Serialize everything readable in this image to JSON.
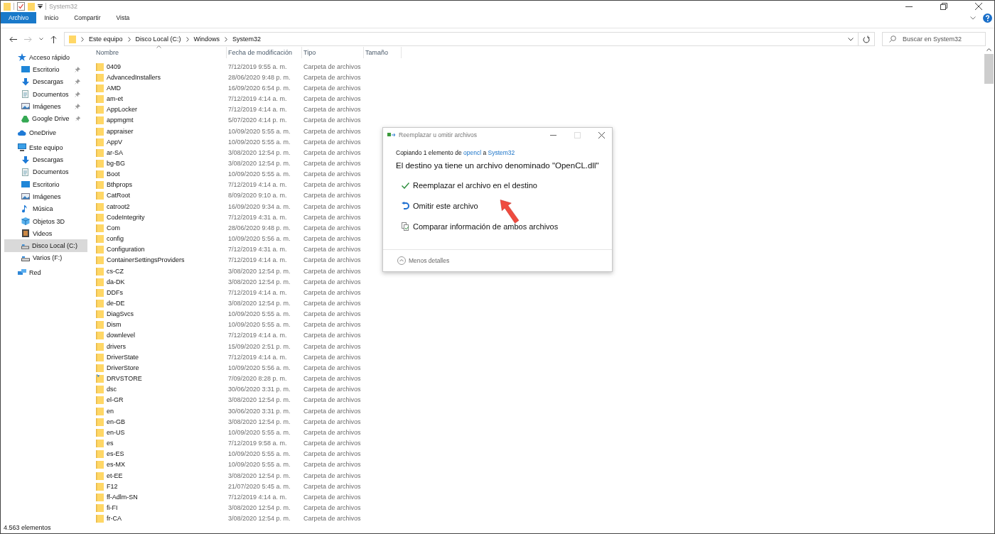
{
  "window": {
    "title": "System32"
  },
  "ribbon_tabs": [
    {
      "label": "Archivo",
      "selected": true
    },
    {
      "label": "Inicio",
      "selected": false
    },
    {
      "label": "Compartir",
      "selected": false
    },
    {
      "label": "Vista",
      "selected": false
    }
  ],
  "address": {
    "segments": [
      "Este equipo",
      "Disco Local (C:)",
      "Windows",
      "System32"
    ]
  },
  "search": {
    "placeholder": "Buscar en System32"
  },
  "sidebar": {
    "items": [
      {
        "label": "Acceso rápido",
        "kind": "star",
        "selected": false,
        "children": [
          {
            "label": "Escritorio",
            "kind": "desktop",
            "pinned": true,
            "selected": false
          },
          {
            "label": "Descargas",
            "kind": "download",
            "pinned": true,
            "selected": false
          },
          {
            "label": "Documentos",
            "kind": "document",
            "pinned": true,
            "selected": false
          },
          {
            "label": "Imágenes",
            "kind": "pictures",
            "pinned": true,
            "selected": false
          },
          {
            "label": "Google Drive",
            "kind": "gdrive",
            "pinned": true,
            "selected": false
          }
        ]
      },
      {
        "label": "OneDrive",
        "kind": "cloud",
        "selected": false
      },
      {
        "label": "Este equipo",
        "kind": "pc",
        "selected": false,
        "children": [
          {
            "label": "Descargas",
            "kind": "download",
            "pinned": false,
            "selected": false
          },
          {
            "label": "Documentos",
            "kind": "document",
            "pinned": false,
            "selected": false
          },
          {
            "label": "Escritorio",
            "kind": "desktop",
            "pinned": false,
            "selected": false
          },
          {
            "label": "Imágenes",
            "kind": "pictures",
            "pinned": false,
            "selected": false
          },
          {
            "label": "Música",
            "kind": "music",
            "pinned": false,
            "selected": false
          },
          {
            "label": "Objetos 3D",
            "kind": "cube",
            "pinned": false,
            "selected": false
          },
          {
            "label": "Videos",
            "kind": "video",
            "pinned": false,
            "selected": false
          },
          {
            "label": "Disco Local (C:)",
            "kind": "drive",
            "pinned": false,
            "selected": true
          },
          {
            "label": "Varios (F:)",
            "kind": "drive",
            "pinned": false,
            "selected": false
          }
        ]
      },
      {
        "label": "Red",
        "kind": "network",
        "selected": false
      }
    ]
  },
  "table": {
    "columns": [
      "Nombre",
      "Fecha de modificación",
      "Tipo",
      "Tamaño"
    ],
    "rows": [
      {
        "kind": "folder",
        "name": "0409",
        "date": "7/12/2019 9:55 a. m.",
        "type": "Carpeta de archivos"
      },
      {
        "kind": "folder",
        "name": "AdvancedInstallers",
        "date": "28/06/2020 9:48 p. m.",
        "type": "Carpeta de archivos"
      },
      {
        "kind": "folder",
        "name": "AMD",
        "date": "16/09/2020 6:54 p. m.",
        "type": "Carpeta de archivos"
      },
      {
        "kind": "folder",
        "name": "am-et",
        "date": "7/12/2019 4:14 a. m.",
        "type": "Carpeta de archivos"
      },
      {
        "kind": "folder",
        "name": "AppLocker",
        "date": "7/12/2019 4:14 a. m.",
        "type": "Carpeta de archivos"
      },
      {
        "kind": "folder",
        "name": "appmgmt",
        "date": "5/07/2020 4:14 p. m.",
        "type": "Carpeta de archivos"
      },
      {
        "kind": "folder",
        "name": "appraiser",
        "date": "10/09/2020 5:55 a. m.",
        "type": "Carpeta de archivos"
      },
      {
        "kind": "folder",
        "name": "AppV",
        "date": "10/09/2020 5:55 a. m.",
        "type": "Carpeta de archivos"
      },
      {
        "kind": "folder",
        "name": "ar-SA",
        "date": "3/08/2020 12:54 p. m.",
        "type": "Carpeta de archivos"
      },
      {
        "kind": "folder",
        "name": "bg-BG",
        "date": "3/08/2020 12:54 p. m.",
        "type": "Carpeta de archivos"
      },
      {
        "kind": "folder",
        "name": "Boot",
        "date": "10/09/2020 5:55 a. m.",
        "type": "Carpeta de archivos"
      },
      {
        "kind": "folder",
        "name": "Bthprops",
        "date": "7/12/2019 4:14 a. m.",
        "type": "Carpeta de archivos"
      },
      {
        "kind": "folder",
        "name": "CatRoot",
        "date": "8/09/2020 9:10 a. m.",
        "type": "Carpeta de archivos"
      },
      {
        "kind": "folder",
        "name": "catroot2",
        "date": "16/09/2020 9:34 a. m.",
        "type": "Carpeta de archivos"
      },
      {
        "kind": "folder",
        "name": "CodeIntegrity",
        "date": "7/12/2019 4:31 a. m.",
        "type": "Carpeta de archivos"
      },
      {
        "kind": "folder",
        "name": "Com",
        "date": "28/06/2020 9:48 p. m.",
        "type": "Carpeta de archivos"
      },
      {
        "kind": "folder",
        "name": "config",
        "date": "10/09/2020 5:56 a. m.",
        "type": "Carpeta de archivos"
      },
      {
        "kind": "folder",
        "name": "Configuration",
        "date": "7/12/2019 4:31 a. m.",
        "type": "Carpeta de archivos"
      },
      {
        "kind": "folder",
        "name": "ContainerSettingsProviders",
        "date": "7/12/2019 4:14 a. m.",
        "type": "Carpeta de archivos"
      },
      {
        "kind": "folder",
        "name": "cs-CZ",
        "date": "3/08/2020 12:54 p. m.",
        "type": "Carpeta de archivos"
      },
      {
        "kind": "folder",
        "name": "da-DK",
        "date": "3/08/2020 12:54 p. m.",
        "type": "Carpeta de archivos"
      },
      {
        "kind": "folder",
        "name": "DDFs",
        "date": "7/12/2019 4:14 a. m.",
        "type": "Carpeta de archivos"
      },
      {
        "kind": "folder",
        "name": "de-DE",
        "date": "3/08/2020 12:54 p. m.",
        "type": "Carpeta de archivos"
      },
      {
        "kind": "folder",
        "name": "DiagSvcs",
        "date": "10/09/2020 5:55 a. m.",
        "type": "Carpeta de archivos"
      },
      {
        "kind": "folder",
        "name": "Dism",
        "date": "10/09/2020 5:55 a. m.",
        "type": "Carpeta de archivos"
      },
      {
        "kind": "folder",
        "name": "downlevel",
        "date": "7/12/2019 4:14 a. m.",
        "type": "Carpeta de archivos"
      },
      {
        "kind": "folder",
        "name": "drivers",
        "date": "15/09/2020 2:51 p. m.",
        "type": "Carpeta de archivos"
      },
      {
        "kind": "folder",
        "name": "DriverState",
        "date": "7/12/2019 4:14 a. m.",
        "type": "Carpeta de archivos"
      },
      {
        "kind": "folder",
        "name": "DriverStore",
        "date": "10/09/2020 5:56 a. m.",
        "type": "Carpeta de archivos"
      },
      {
        "kind": "link",
        "name": "DRVSTORE",
        "date": "7/09/2020 8:28 p. m.",
        "type": "Carpeta de archivos"
      },
      {
        "kind": "folder",
        "name": "dsc",
        "date": "30/06/2020 3:31 p. m.",
        "type": "Carpeta de archivos"
      },
      {
        "kind": "folder",
        "name": "el-GR",
        "date": "3/08/2020 12:54 p. m.",
        "type": "Carpeta de archivos"
      },
      {
        "kind": "folder",
        "name": "en",
        "date": "30/06/2020 3:31 p. m.",
        "type": "Carpeta de archivos"
      },
      {
        "kind": "folder",
        "name": "en-GB",
        "date": "3/08/2020 12:54 p. m.",
        "type": "Carpeta de archivos"
      },
      {
        "kind": "folder",
        "name": "en-US",
        "date": "10/09/2020 5:55 a. m.",
        "type": "Carpeta de archivos"
      },
      {
        "kind": "folder",
        "name": "es",
        "date": "7/12/2019 9:58 a. m.",
        "type": "Carpeta de archivos"
      },
      {
        "kind": "folder",
        "name": "es-ES",
        "date": "10/09/2020 5:55 a. m.",
        "type": "Carpeta de archivos"
      },
      {
        "kind": "folder",
        "name": "es-MX",
        "date": "10/09/2020 5:55 a. m.",
        "type": "Carpeta de archivos"
      },
      {
        "kind": "folder",
        "name": "et-EE",
        "date": "3/08/2020 12:54 p. m.",
        "type": "Carpeta de archivos"
      },
      {
        "kind": "folder",
        "name": "F12",
        "date": "21/07/2020 5:45 a. m.",
        "type": "Carpeta de archivos"
      },
      {
        "kind": "folder",
        "name": "ff-Adlm-SN",
        "date": "7/12/2019 4:14 a. m.",
        "type": "Carpeta de archivos"
      },
      {
        "kind": "folder",
        "name": "fi-FI",
        "date": "3/08/2020 12:54 p. m.",
        "type": "Carpeta de archivos"
      },
      {
        "kind": "folder",
        "name": "fr-CA",
        "date": "3/08/2020 12:54 p. m.",
        "type": "Carpeta de archivos"
      }
    ]
  },
  "status_bar": {
    "count": "4.563 elementos"
  },
  "dialog": {
    "title": "Reemplazar u omitir archivos",
    "copy_line": {
      "prefix": "Copiando 1 elemento de",
      "source": "opencl",
      "middle": "a",
      "destination": "System32"
    },
    "heading": "El destino ya tiene un archivo denominado \"OpenCL.dll\"",
    "options": [
      {
        "kind": "replace",
        "label": "Reemplazar el archivo en el destino"
      },
      {
        "kind": "skip",
        "label": "Omitir este archivo"
      },
      {
        "kind": "compare",
        "label": "Comparar información de ambos archivos"
      }
    ],
    "details_toggle": "Menos detalles"
  }
}
